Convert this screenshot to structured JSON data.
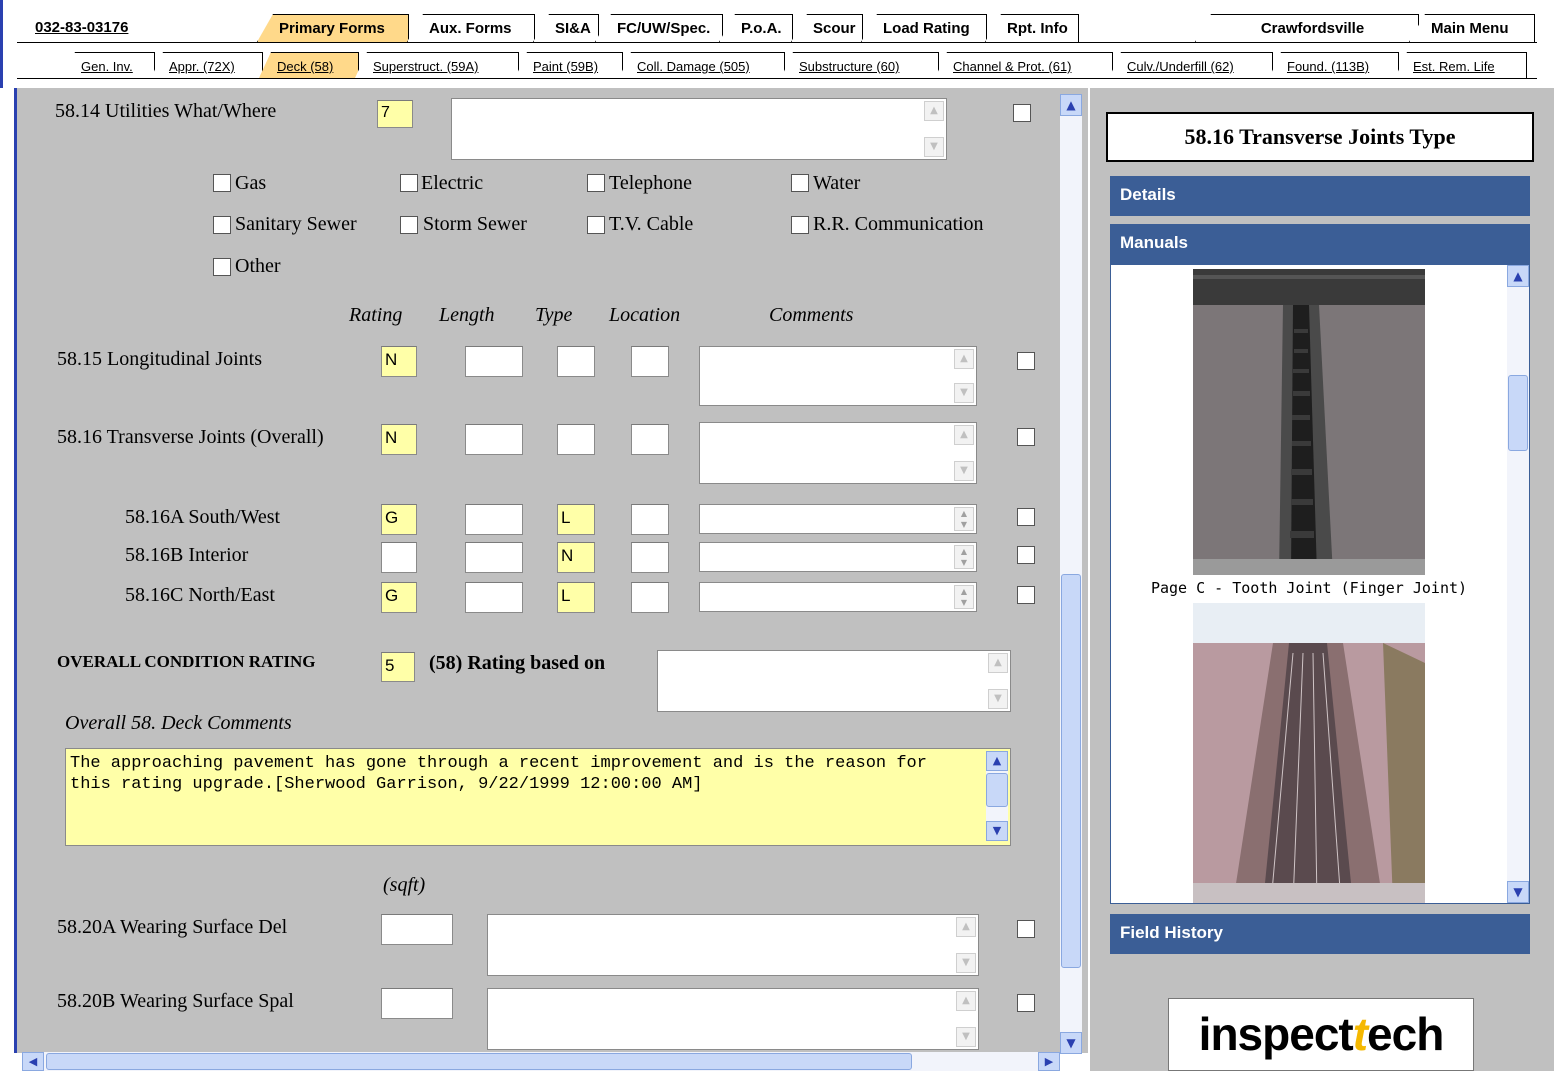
{
  "header": {
    "bridge_id": "032-83-03176",
    "primary_tabs": [
      "Primary Forms",
      "Aux. Forms",
      "SI&A",
      "FC/UW/Spec.",
      "P.o.A.",
      "Scour",
      "Load Rating",
      "Rpt. Info"
    ],
    "right_tabs": [
      "Crawfordsville",
      "Main Menu"
    ],
    "sub_tabs": [
      "Gen. Inv.",
      "Appr. (72X)",
      "Deck (58)",
      "Superstruct. (59A)",
      "Paint (59B)",
      "Coll. Damage (505)",
      "Substructure (60)",
      "Channel & Prot. (61)",
      "Culv./Underfill (62)",
      "Found. (113B)",
      "Est. Rem. Life"
    ]
  },
  "form": {
    "utilities": {
      "label": "58.14 Utilities What/Where",
      "value": "7",
      "options": [
        "Gas",
        "Electric",
        "Telephone",
        "Water",
        "Sanitary Sewer",
        "Storm Sewer",
        "T.V. Cable",
        "R.R. Communication",
        "Other"
      ]
    },
    "col_headers": [
      "Rating",
      "Length",
      "Type",
      "Location",
      "Comments"
    ],
    "longitudinal": {
      "label": "58.15 Longitudinal Joints",
      "rating": "N"
    },
    "transverse": {
      "label": "58.16 Transverse Joints (Overall)",
      "rating": "N"
    },
    "joints": [
      {
        "label": "58.16A South/West",
        "rating": "G",
        "type": "L"
      },
      {
        "label": "58.16B Interior",
        "rating": "",
        "type": "N"
      },
      {
        "label": "58.16C North/East",
        "rating": "G",
        "type": "L"
      }
    ],
    "overall": {
      "label": "OVERALL CONDITION RATING",
      "value": "5",
      "based_on": "(58) Rating based on"
    },
    "comments_label": "Overall 58. Deck Comments",
    "comments_text": "The approaching pavement has gone through a recent improvement and is the reason for this rating upgrade.[Sherwood Garrison, 9/22/1999 12:00:00 AM]",
    "sqft": "(sqft)",
    "wearing_del": "58.20A Wearing Surface Del",
    "wearing_spal": "58.20B Wearing Surface Spal"
  },
  "side": {
    "title": "58.16 Transverse Joints Type",
    "details": "Details",
    "manuals": "Manuals",
    "caption": "Page C - Tooth Joint (Finger Joint)",
    "field_history": "Field History",
    "logo_a": "inspect",
    "logo_t": "t",
    "logo_b": "ech"
  },
  "colors": {
    "accent_tab": "#ffd98a",
    "field_yellow": "#ffffa8",
    "panel_bar": "#3b5e96",
    "scroll_blue": "#c8d8f8"
  }
}
